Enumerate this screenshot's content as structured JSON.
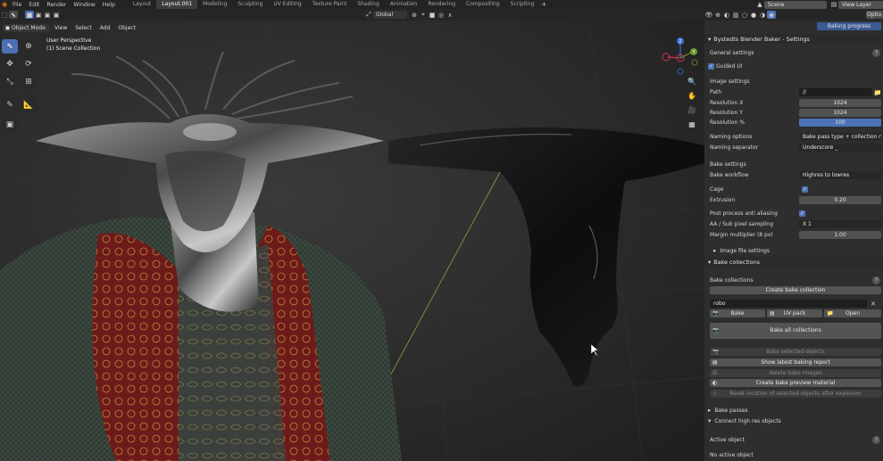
{
  "menu": [
    "File",
    "Edit",
    "Render",
    "Window",
    "Help"
  ],
  "workspaces": [
    {
      "label": "Layout",
      "active": false
    },
    {
      "label": "Layout.001",
      "active": true
    },
    {
      "label": "Modeling",
      "active": false
    },
    {
      "label": "Sculpting",
      "active": false
    },
    {
      "label": "UV Editing",
      "active": false
    },
    {
      "label": "Texture Paint",
      "active": false
    },
    {
      "label": "Shading",
      "active": false
    },
    {
      "label": "Animation",
      "active": false
    },
    {
      "label": "Rendering",
      "active": false
    },
    {
      "label": "Compositing",
      "active": false
    },
    {
      "label": "Scripting",
      "active": false
    }
  ],
  "top_right": {
    "scene": "Scene",
    "view_layer": "View Layer",
    "options": "Optio"
  },
  "viewport_header": {
    "transform_orientation": "Global"
  },
  "viewport_menu": {
    "mode": "Object Mode",
    "items": [
      "View",
      "Select",
      "Add",
      "Object"
    ]
  },
  "overlay": {
    "perspective": "User Perspective",
    "collection": "(1) Scene Collection"
  },
  "nav_gizmo": {
    "x": "X",
    "y": "Y",
    "z": "Z"
  },
  "panel": {
    "tab_label": "Baking progress",
    "title": "Bystedts Blender Baker - Settings",
    "general": {
      "header": "General settings",
      "guided_ui": "Guided UI"
    },
    "image": {
      "header": "Image settings",
      "path_label": "Path",
      "path_value": "//",
      "resx_label": "Resolution X",
      "resx_value": "1024",
      "resy_label": "Resolution Y",
      "resy_value": "1024",
      "resp_label": "Resolution %",
      "resp_value": "100",
      "naming_label": "Naming options",
      "naming_value": "Bake pass type + collection na...",
      "sep_label": "Naming separator",
      "sep_value": "Underscore _"
    },
    "bake": {
      "header": "Bake settings",
      "workflow_label": "Bake workflow",
      "workflow_value": "Highres to lowres",
      "cage_label": "Cage",
      "extrusion_label": "Extrusion",
      "extrusion_value": "0.20",
      "ppaa_label": "Post process anti aliasing",
      "aa_label": "AA / Sub pixel sampling",
      "aa_value": "X 1",
      "margin_label": "Margin multiplier (8 px)",
      "margin_value": "1.00"
    },
    "image_file_settings": "Image file settings",
    "bake_collections_section": "Bake collections",
    "collections": {
      "header": "Bake collections",
      "create_btn": "Create bake collection",
      "collection_name": "robo",
      "bake_btn": "Bake",
      "uvpack_btn": "UV pack",
      "open_btn": "Open",
      "bake_all_btn": "Bake all collections",
      "bake_selected_btn": "Bake selected objects",
      "show_report_btn": "Show latest baking report",
      "delete_images_btn": "delete bake images",
      "preview_mat_btn": "Create bake preview material",
      "reset_btn": "Reset location of selected objects after explosion"
    },
    "bake_passes": "Bake passes",
    "connect": "Connect high res objects",
    "active_object_label": "Active object",
    "no_active_object": "No active object"
  }
}
